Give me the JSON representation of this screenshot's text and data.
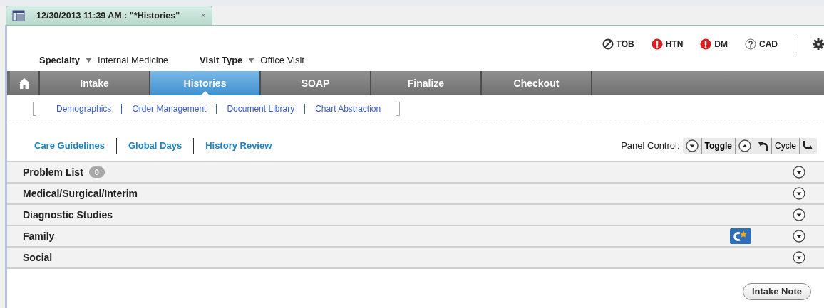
{
  "document_tab": {
    "title": "12/30/2013 11:39 AM : \"*Histories\"",
    "close": "×"
  },
  "flags": [
    {
      "kind": "none",
      "label": "TOB"
    },
    {
      "kind": "alert",
      "label": "HTN"
    },
    {
      "kind": "alert",
      "label": "DM"
    },
    {
      "kind": "unknown",
      "label": "CAD"
    }
  ],
  "specialty": {
    "label": "Specialty",
    "value": "Internal Medicine"
  },
  "visit_type": {
    "label": "Visit Type",
    "value": "Office Visit"
  },
  "workflow_tabs": [
    {
      "label": "Intake",
      "selected": false
    },
    {
      "label": "Histories",
      "selected": true
    },
    {
      "label": "SOAP",
      "selected": false
    },
    {
      "label": "Finalize",
      "selected": false
    },
    {
      "label": "Checkout",
      "selected": false
    }
  ],
  "sub_links": [
    "Demographics",
    "Order Management",
    "Document Library",
    "Chart Abstraction"
  ],
  "view_links": [
    "Care Guidelines",
    "Global Days",
    "History Review"
  ],
  "panel_control": {
    "label": "Panel Control:",
    "toggle": "Toggle",
    "cycle": "Cycle"
  },
  "sections": [
    {
      "title": "Problem List",
      "count": "0",
      "flagged": false
    },
    {
      "title": "Medical/Surgical/Interim",
      "flagged": false
    },
    {
      "title": "Diagnostic Studies",
      "flagged": false
    },
    {
      "title": "Family",
      "flagged": true
    },
    {
      "title": "Social",
      "flagged": false
    }
  ],
  "footer_button": "Intake Note"
}
